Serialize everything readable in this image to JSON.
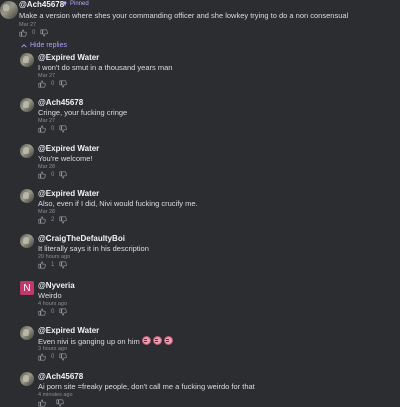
{
  "top_comment": {
    "username": "@Ach45678",
    "pinned_label": "Pinned",
    "text": "Make a version where shes your commanding officer and she lowkey trying to do a non consensual",
    "time": "Mar 27",
    "likes": "0"
  },
  "hide_replies_label": "Hide replies",
  "replies": [
    {
      "username": "@Expired Water",
      "text": "I won't do smut in a thousand years man",
      "time": "Mar 27",
      "likes": "0"
    },
    {
      "username": "@Ach45678",
      "text": "Cringe, your fucking cringe",
      "time": "Mar 27",
      "likes": "0"
    },
    {
      "username": "@Expired Water",
      "text": "You're welcome!",
      "time": "Mar 28",
      "likes": "0"
    },
    {
      "username": "@Expired Water",
      "text": "Also, even if I did, Nivi would fucking crucify me.",
      "time": "Mar 28",
      "likes": "2"
    },
    {
      "username": "@CraigTheDefaultyBoi",
      "text": "It literally says it in his description",
      "time": "20 hours ago",
      "likes": "1"
    },
    {
      "username": "@Nyveria",
      "avatar_letter": "N",
      "text": "Weirdo",
      "time": "4 hours ago",
      "likes": "0"
    },
    {
      "username": "@Expired Water",
      "text": "Even nivi is ganging up on him",
      "time": "3 hours ago",
      "likes": "0"
    },
    {
      "username": "@Ach45678",
      "text": "Ai porn site =freaky people, don't call me a fucking weirdo for that",
      "time": "4 minutes ago",
      "likes": ""
    }
  ],
  "icons": {
    "like": "thumbs-up-icon",
    "dislike": "thumbs-down-icon",
    "pin": "pin-icon",
    "chevron": "chevron-up-icon"
  },
  "colors": {
    "background": "#2b2d31",
    "accent": "#a9a0ff",
    "nyveria_avatar": "#c2386a"
  }
}
